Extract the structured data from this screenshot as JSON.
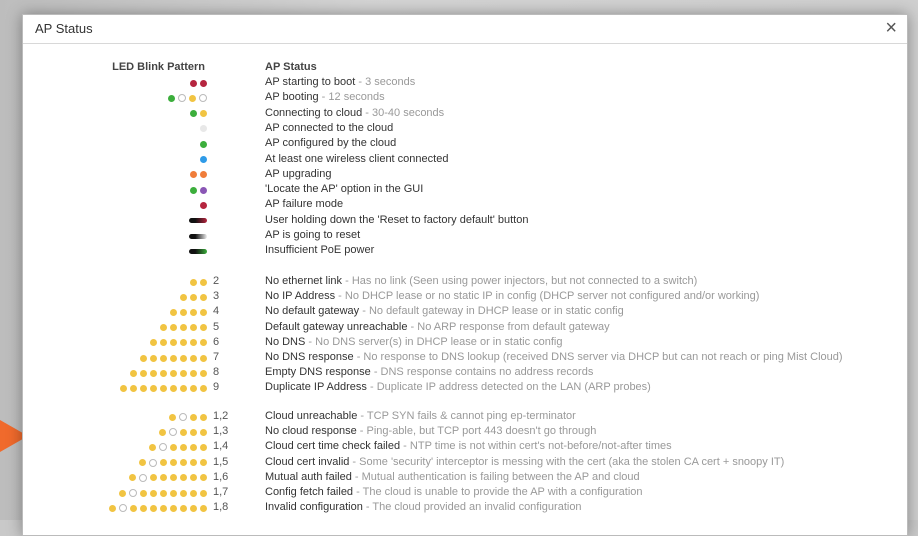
{
  "dialog": {
    "title": "AP Status",
    "close_label": "×",
    "left_header": "LED Blink Pattern",
    "right_header": "AP Status"
  },
  "colors": {
    "red": "#b5253f",
    "green": "#3cae3c",
    "yellow": "#f1c442",
    "blue": "#2f9be8",
    "orange": "#f07d3a",
    "purple": "#8a56b5",
    "light": "#e8e8e8",
    "empty": "#ffffff"
  },
  "basic_patterns": [
    {
      "leds": [
        "red",
        "red"
      ],
      "title": "AP starting to boot",
      "desc": " - 3 seconds"
    },
    {
      "leds": [
        "green",
        "empty",
        "yellow",
        "empty"
      ],
      "title": "AP booting",
      "desc": " - 12 seconds"
    },
    {
      "leds": [
        "green",
        "yellow"
      ],
      "title": "Connecting to cloud",
      "desc": " - 30-40 seconds"
    },
    {
      "leds": [
        "light"
      ],
      "title": "AP connected to the cloud",
      "desc": ""
    },
    {
      "leds": [
        "green"
      ],
      "title": "AP configured by the cloud",
      "desc": ""
    },
    {
      "leds": [
        "blue"
      ],
      "title": "At least one wireless client connected",
      "desc": ""
    },
    {
      "leds": [
        "orange",
        "orange"
      ],
      "title": "AP upgrading",
      "desc": ""
    },
    {
      "leds": [
        "green",
        "purple"
      ],
      "title": "'Locate the AP' option in the GUI",
      "desc": ""
    },
    {
      "leds": [
        "red"
      ],
      "title": "AP failure mode",
      "desc": ""
    },
    {
      "leds": [
        "bar-red"
      ],
      "title": "User holding down the 'Reset to factory default' button",
      "desc": ""
    },
    {
      "leds": [
        "bar-black"
      ],
      "title": "AP is going to reset",
      "desc": ""
    },
    {
      "leds": [
        "bar-green"
      ],
      "title": "Insufficient PoE power",
      "desc": ""
    }
  ],
  "yellow_patterns": [
    {
      "count": 2,
      "num": "2",
      "title": "No ethernet link",
      "desc": " - Has no link (Seen using power injectors, but not connected to a switch)"
    },
    {
      "count": 3,
      "num": "3",
      "title": "No IP Address",
      "desc": " - No DHCP lease or no static IP in config (DHCP server not configured and/or working)"
    },
    {
      "count": 4,
      "num": "4",
      "title": "No default gateway",
      "desc": " - No default gateway in DHCP lease or in static config"
    },
    {
      "count": 5,
      "num": "5",
      "title": "Default gateway unreachable",
      "desc": " - No ARP response from default gateway"
    },
    {
      "count": 6,
      "num": "6",
      "title": "No DNS",
      "desc": " - No DNS server(s) in DHCP lease or in static config"
    },
    {
      "count": 7,
      "num": "7",
      "title": "No DNS response",
      "desc": " - No response to DNS lookup (received DNS server via DHCP but can not reach or ping Mist Cloud)"
    },
    {
      "count": 8,
      "num": "8",
      "title": "Empty DNS response",
      "desc": " - DNS response contains no address records"
    },
    {
      "count": 9,
      "num": "9",
      "title": "Duplicate IP Address",
      "desc": " - Duplicate IP address detected on the LAN (ARP probes)"
    }
  ],
  "cloud_patterns": [
    {
      "tail": 2,
      "num": "1,2",
      "title": "Cloud unreachable",
      "desc": " - TCP SYN fails & cannot ping ep-terminator"
    },
    {
      "tail": 3,
      "num": "1,3",
      "title": "No cloud response",
      "desc": " - Ping-able, but TCP port 443 doesn't go through"
    },
    {
      "tail": 4,
      "num": "1,4",
      "title": "Cloud cert time check failed",
      "desc": " - NTP time is not within cert's not-before/not-after times"
    },
    {
      "tail": 5,
      "num": "1,5",
      "title": "Cloud cert invalid",
      "desc": " - Some 'security' interceptor is messing with the cert (aka the stolen CA cert + snoopy IT)"
    },
    {
      "tail": 6,
      "num": "1,6",
      "title": "Mutual auth failed",
      "desc": " - Mutual authentication is failing between the AP and cloud"
    },
    {
      "tail": 7,
      "num": "1,7",
      "title": "Config fetch failed",
      "desc": " - The cloud is unable to provide the AP with a configuration"
    },
    {
      "tail": 8,
      "num": "1,8",
      "title": "Invalid configuration",
      "desc": " - The cloud provided an invalid configuration"
    }
  ]
}
